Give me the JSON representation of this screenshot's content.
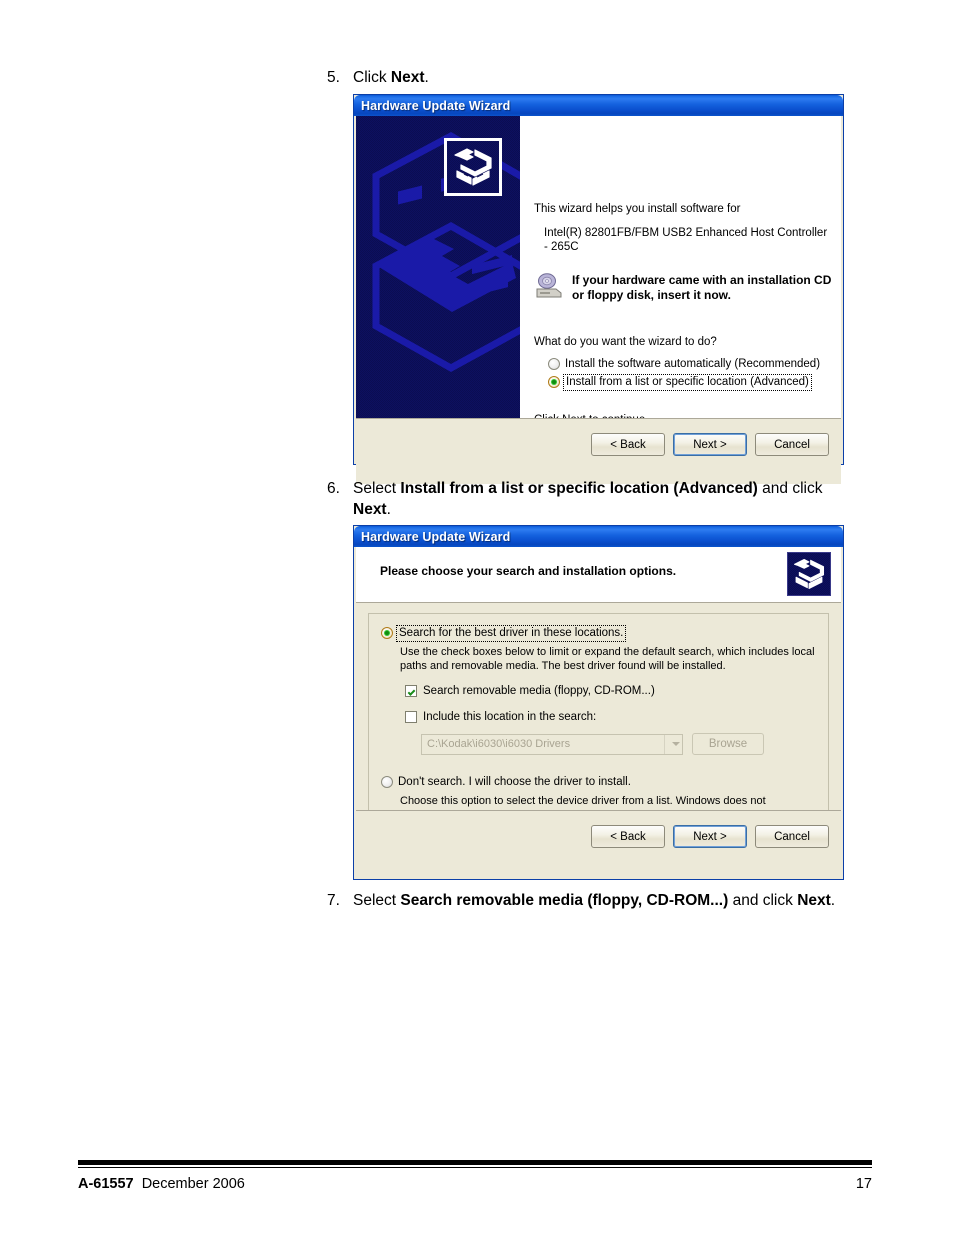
{
  "document": {
    "footer": {
      "doc_number": "A-61557",
      "date": "December 2006",
      "page_number": "17"
    }
  },
  "steps": {
    "step5": {
      "number": "5.",
      "text_parts": [
        "Click ",
        "Next",
        "."
      ]
    },
    "step6": {
      "number": "6.",
      "text_parts": [
        "Select ",
        "Install from a list or specific location (Advanced)",
        " and click ",
        "Next",
        "."
      ]
    },
    "step7": {
      "number": "7.",
      "text_parts": [
        "Select ",
        "Search removable media (floppy, CD-ROM...)",
        " and click ",
        "Next",
        "."
      ]
    }
  },
  "dialog1": {
    "title": "Hardware Update Wizard",
    "lead": "This wizard helps you install software for",
    "device": "Intel(R) 82801FB/FBM USB2 Enhanced Host Controller - 265C",
    "cd_note_line1": "If your hardware came with an installation CD",
    "cd_note_line2": "or floppy disk, insert it now.",
    "question": "What do you want the wizard to do?",
    "options": [
      {
        "label": "Install the software automatically (Recommended)",
        "selected": false,
        "focused": false
      },
      {
        "label": "Install from a list or specific location (Advanced)",
        "selected": true,
        "focused": true
      }
    ],
    "footer_note": "Click Next to continue.",
    "buttons": {
      "back": "< Back",
      "next": "Next >",
      "cancel": "Cancel"
    }
  },
  "dialog2": {
    "title": "Hardware Update Wizard",
    "header_title": "Please choose your search and installation options.",
    "option_search": {
      "label": "Search for the best driver in these locations.",
      "selected": true,
      "focused": true,
      "description": "Use the check boxes below to limit or expand the default search, which includes local paths and removable media. The best driver found will be installed.",
      "checkboxes": [
        {
          "label": "Search removable media (floppy, CD-ROM...)",
          "checked": true
        },
        {
          "label": "Include this location in the search:",
          "checked": false
        }
      ],
      "path_value": "C:\\Kodak\\i6030\\i6030 Drivers",
      "browse_label": "Browse",
      "browse_disabled": true
    },
    "option_no_search": {
      "label": "Don't search. I will choose the driver to install.",
      "selected": false,
      "description": "Choose this option to select the device driver from a list.  Windows does not guarantee that the driver you choose will be the best match for your hardware."
    },
    "buttons": {
      "back": "< Back",
      "next": "Next >",
      "cancel": "Cancel"
    }
  },
  "colors": {
    "titlebar_blue": "#0b50cf",
    "dialog_face": "#ece9d8",
    "banner_navy": "#0b0d52",
    "banner_shape_blue": "#1616a8",
    "focus_border": "#3a6ea5"
  }
}
